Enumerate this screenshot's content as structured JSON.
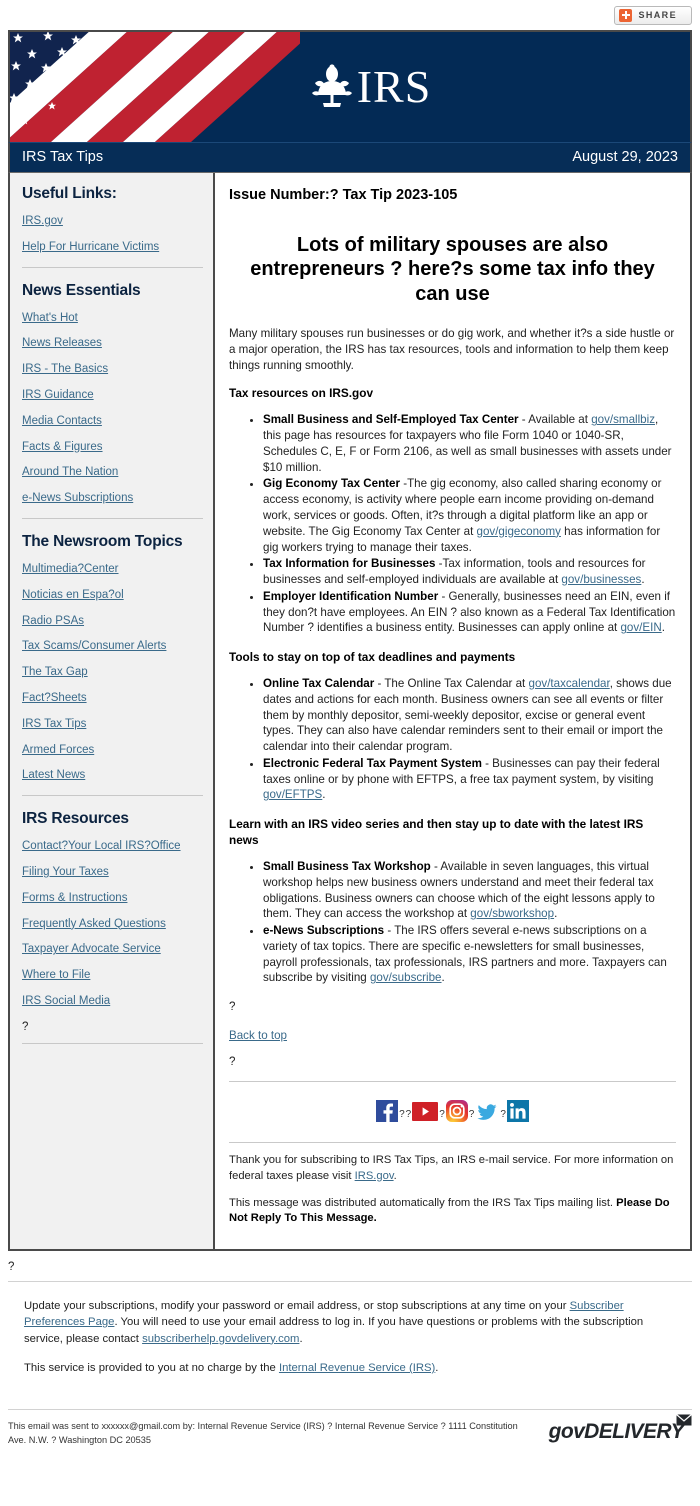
{
  "share": {
    "label": "SHARE",
    "icon": "share-plus-icon"
  },
  "masthead": {
    "logo_text": "IRS",
    "flag_alt": "american-flag",
    "bg_color": "#032a55"
  },
  "titlebar": {
    "publication": "IRS Tax Tips",
    "date": "August 29, 2023"
  },
  "sidebar": {
    "sections": [
      {
        "heading": "Useful Links:",
        "links": [
          "IRS.gov",
          "Help For Hurricane Victims"
        ]
      },
      {
        "heading": "News Essentials",
        "links": [
          "What's Hot",
          "News Releases",
          "IRS - The Basics",
          "IRS Guidance",
          "Media Contacts",
          "Facts & Figures",
          "Around The Nation",
          "e-News Subscriptions"
        ]
      },
      {
        "heading": "The Newsroom Topics",
        "links": [
          "Multimedia?Center",
          "Noticias en Espa?ol",
          "Radio PSAs",
          "Tax Scams/Consumer Alerts",
          "The Tax Gap",
          "Fact?Sheets",
          "IRS Tax Tips",
          "Armed Forces",
          "Latest News"
        ]
      },
      {
        "heading": "IRS Resources",
        "links": [
          "Contact?Your Local IRS?Office",
          "Filing Your Taxes",
          "Forms & Instructions",
          "Frequently Asked Questions",
          "Taxpayer Advocate Service",
          "Where to File",
          "IRS Social Media"
        ],
        "trailing_char": "?"
      }
    ]
  },
  "article": {
    "issue_number": "Issue Number:? Tax Tip 2023-105",
    "headline": "Lots of military spouses are also entrepreneurs ? here?s some tax info they can use",
    "intro": "Many military spouses run businesses or do gig work, and whether it?s a side hustle or a major operation, the IRS has tax resources, tools and information to help them keep things running smoothly.",
    "sections": [
      {
        "heading": "Tax resources on IRS.gov",
        "bullets": [
          {
            "term": "Small Business and Self-Employed Tax Center",
            "text_before": " - Available at ",
            "link": "gov/smallbiz",
            "text_after": ", this page has resources for taxpayers who file Form 1040 or 1040-SR, Schedules C, E, F or Form 2106, as well as small businesses with assets under $10 million."
          },
          {
            "term": "Gig Economy Tax Center",
            "text_before": " -The gig economy, also called sharing economy or access economy, is activity where people earn income providing on-demand work, services or goods. Often, it?s through a digital platform like an app or website. The Gig Economy Tax Center at ",
            "link": "gov/gigeconomy",
            "text_after": " has information for gig workers trying to manage their taxes."
          },
          {
            "term": "Tax Information for Businesses",
            "text_before": " -Tax information, tools and resources for businesses and self-employed individuals are available at ",
            "link": "gov/businesses",
            "text_after": "."
          },
          {
            "term": "Employer Identification Number",
            "text_before": " - Generally, businesses need an EIN, even if they don?t have employees. An EIN ? also known as a Federal Tax Identification Number ? identifies a business entity. Businesses can apply online at ",
            "link": "gov/EIN",
            "text_after": "."
          }
        ]
      },
      {
        "heading": "Tools to stay on top of tax deadlines and payments",
        "bullets": [
          {
            "term": "Online Tax Calendar",
            "text_before": " - The Online Tax Calendar at ",
            "link": "gov/taxcalendar",
            "text_after": ", shows due dates and actions for each month. Business owners can see all events or filter them by monthly depositor, semi-weekly depositor, excise or general event types. They can also have calendar reminders sent to their email or import the calendar into their calendar program."
          },
          {
            "term": "Electronic Federal Tax Payment System",
            "text_before": " - Businesses can pay their federal taxes online or by phone with EFTPS, a free tax payment system, by visiting ",
            "link": "gov/EFTPS",
            "text_after": "."
          }
        ]
      },
      {
        "heading": "Learn with an IRS video series and then stay up to date with the latest IRS news",
        "bullets": [
          {
            "term": "Small Business Tax Workshop",
            "text_before": " - Available in seven languages, this virtual workshop helps new business owners understand and meet their federal tax obligations. Business owners can choose which of the eight lessons apply to them. They can access the workshop at ",
            "link": "gov/sbworkshop",
            "text_after": "."
          },
          {
            "term": "e-News Subscriptions",
            "text_before": " - The IRS offers several e-news subscriptions on a variety of tax topics. There are specific e-newsletters for small businesses, payroll professionals, tax professionals, IRS partners and more. Taxpayers can subscribe by visiting ",
            "link": "gov/subscribe",
            "text_after": "."
          }
        ]
      }
    ],
    "spacer_char": "?",
    "back_to_top": "Back to top"
  },
  "social": {
    "separator": "?",
    "items": [
      {
        "name": "facebook",
        "label": "Facebook"
      },
      {
        "name": "youtube",
        "label": "YouTube"
      },
      {
        "name": "instagram",
        "label": "Instagram"
      },
      {
        "name": "twitter",
        "label": "Twitter"
      },
      {
        "name": "linkedin",
        "label": "LinkedIn"
      }
    ]
  },
  "email_footer": {
    "thanks_before": "Thank you for subscribing to IRS Tax Tips, an IRS e-mail service. For more information on federal taxes please visit ",
    "thanks_link": "IRS.gov",
    "thanks_after": ".",
    "distributed_normal": "This message was distributed automatically from the IRS Tax Tips mailing list. ",
    "distributed_bold": "Please Do Not Reply To This Message."
  },
  "outer_footer": {
    "spacer_char": "?",
    "update_p1a": "Update your subscriptions, modify your password or email address, or stop subscriptions at any time on your ",
    "update_link1": "Subscriber Preferences Page",
    "update_p1b": ". You will need to use your email address to log in. If you have questions or problems with the subscription service, please contact ",
    "update_link2": "subscriberhelp.govdelivery.com",
    "update_p1c": ".",
    "service_before": "This service is provided to you at no charge by the ",
    "service_link": "Internal Revenue Service (IRS)",
    "service_after": ".",
    "sent_to": "This email was sent to xxxxxx@gmail.com by: Internal Revenue Service (IRS) ? Internal Revenue Service ? 1111 Constitution Ave. N.W. ? Washington DC 20535",
    "brand": "govDELIVERY"
  }
}
